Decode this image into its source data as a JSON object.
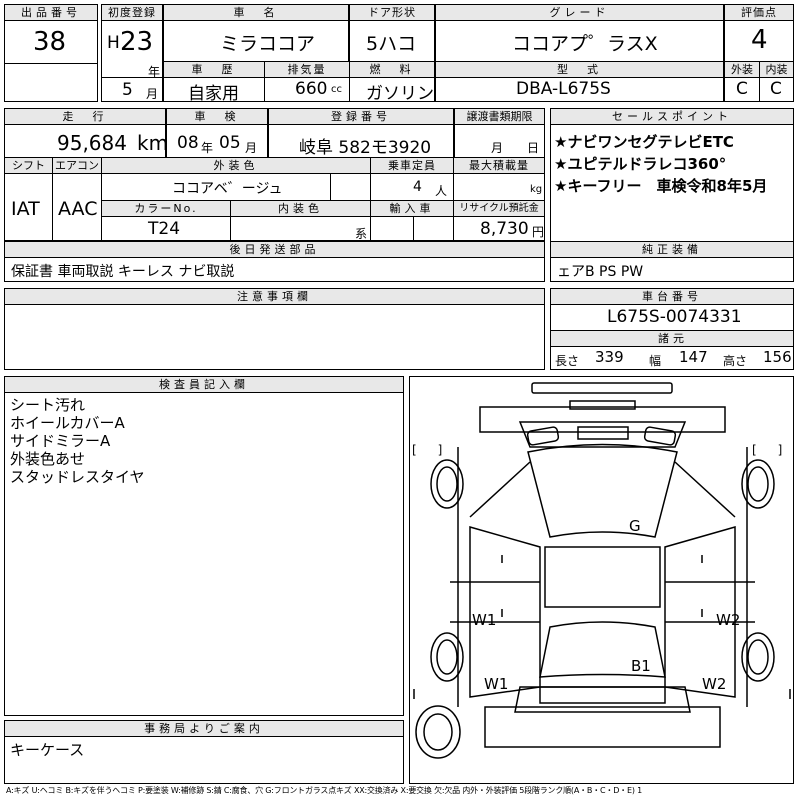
{
  "header": {
    "lot_no_label": "出品番号",
    "lot_no": "38",
    "first_reg_label": "初度登録",
    "era_prefix": "H",
    "year": "23",
    "year_unit": "年",
    "month": "5",
    "month_unit": "月",
    "car_name_label": "車　名",
    "car_name": "ミラココア",
    "door_label": "ドア形状",
    "door": "5ハコ",
    "grade_label": "グレード",
    "grade": "ココアプ゜ラスX",
    "score_label": "評価点",
    "score": "4",
    "history_label": "車　歴",
    "history": "自家用",
    "displacement_label": "排気量",
    "displacement": "660",
    "displacement_unit": "cc",
    "fuel_label": "燃　料",
    "fuel": "ガソリン",
    "model_label": "型　式",
    "model": "DBA-L675S",
    "exterior_label": "外装",
    "exterior": "C",
    "interior_label": "内装",
    "interior": "C"
  },
  "row2": {
    "mileage_label": "走　行",
    "mileage": "95,684",
    "mileage_unit": "km",
    "inspection_label": "車　検",
    "inspection_year": "08",
    "inspection_year_unit": "年",
    "inspection_month": "05",
    "inspection_month_unit": "月",
    "plate_label": "登録番号",
    "plate": "岐阜 582モ3920",
    "transfer_label": "譲渡書類期限",
    "transfer_month_unit": "月",
    "transfer_day_unit": "日",
    "shift_label": "シフト",
    "shift": "IAT",
    "ac_label": "エアコン",
    "ac": "AAC",
    "color_label": "外装色",
    "color": "ココアベ゛ージュ",
    "capacity_label": "乗車定員",
    "capacity": "4",
    "capacity_unit": "人",
    "load_label": "最大積載量",
    "load_unit": "kg",
    "color_no_label": "カラーNo.",
    "color_no": "T24",
    "int_color_label": "内装色",
    "int_color_suffix": "系",
    "import_label": "輸入車",
    "recycle_label": "リサイクル預託金",
    "recycle": "8,730",
    "recycle_unit": "円"
  },
  "sales_points": {
    "label": "セールスポイント",
    "items": [
      "★ナビワンセグテレビETC",
      "★ユピテルドラレコ360°",
      "★キーフリー　車検令和8年5月"
    ]
  },
  "later_parts": {
    "label": "後日発送部品",
    "value": "保証書 車両取説 キーレス ナビ取説"
  },
  "genuine": {
    "label": "純正装備",
    "value": "ェアB PS PW"
  },
  "notes": {
    "label": "注意事項欄"
  },
  "chassis": {
    "label": "車台番号",
    "value": "L675S-0074331",
    "dims_label": "諸元",
    "length_label": "長さ",
    "length": "339",
    "width_label": "幅",
    "width": "147",
    "height_label": "高さ",
    "height": "156"
  },
  "inspector": {
    "label": "検査員記入欄",
    "items": [
      "シート汚れ",
      "ホイールカバーA",
      "サイドミラーA",
      "外装色あせ",
      "スタッドレスタイヤ"
    ]
  },
  "office": {
    "label": "事務局よりご案内",
    "value": "キーケース"
  },
  "diagram": {
    "marks": {
      "g": "G",
      "w1_left": "W1",
      "w2_right": "W2",
      "b1": "B1",
      "w1_lower": "W1",
      "w2_lower": "W2"
    },
    "brackets": "[　　]"
  },
  "legend": "A:キズ U:ヘコミ B:キズを伴うヘコミ P:要塗装 W:補修跡 S:錆 C:腐食、穴 G:フロントガラス点キズ XX:交換済み X:要交換 欠:欠品 内外・外装評価 5段階ランク順(A・B・C・D・E) 1"
}
